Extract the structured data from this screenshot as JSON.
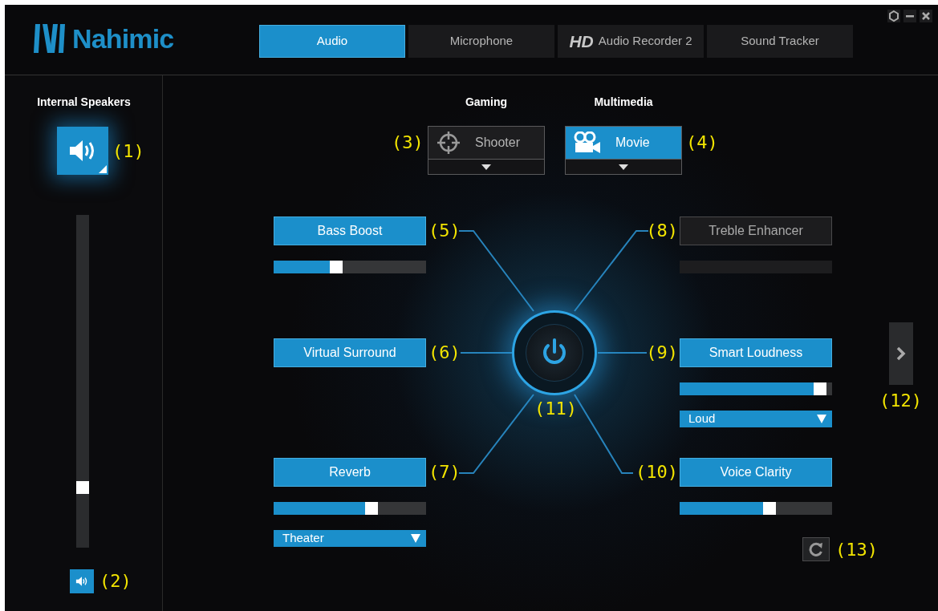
{
  "app": {
    "logo": "Nahimic"
  },
  "tabs": [
    {
      "label": "Audio",
      "selected": true
    },
    {
      "label": "Microphone",
      "selected": false
    },
    {
      "prefix": "HD",
      "label": "Audio Recorder 2",
      "selected": false
    },
    {
      "label": "Sound Tracker",
      "selected": false
    }
  ],
  "sidebar": {
    "device": "Internal Speakers",
    "device_callout": "(1)",
    "volume": {
      "level": 0.18
    },
    "mute_callout": "(2)"
  },
  "presets": [
    {
      "category": "Gaming",
      "name": "Shooter",
      "kind": "shooter",
      "selected": false,
      "callout": "(3)"
    },
    {
      "category": "Multimedia",
      "name": "Movie",
      "kind": "movie",
      "selected": true,
      "callout": "(4)"
    }
  ],
  "effects": [
    {
      "name": "Bass Boost",
      "on": true,
      "callout": "(5)",
      "kind": "slider",
      "level": 0.41
    },
    {
      "name": "Virtual Surround",
      "on": true,
      "callout": "(6)",
      "kind": "plain"
    },
    {
      "name": "Reverb",
      "on": true,
      "callout": "(7)",
      "kind": "slider_dropdown",
      "level": 0.64,
      "dropdown": "Theater"
    },
    {
      "name": "Treble Enhancer",
      "on": false,
      "callout": "(8)",
      "kind": "slider"
    },
    {
      "name": "Smart Loudness",
      "on": true,
      "callout": "(9)",
      "kind": "slider_dropdown",
      "level": 0.92,
      "dropdown": "Loud"
    },
    {
      "name": "Voice Clarity",
      "on": true,
      "callout": "(10)",
      "kind": "slider",
      "level": 0.59
    }
  ],
  "power": {
    "callout": "(11)"
  },
  "next": {
    "callout": "(12)"
  },
  "reset": {
    "callout": "(13)"
  }
}
